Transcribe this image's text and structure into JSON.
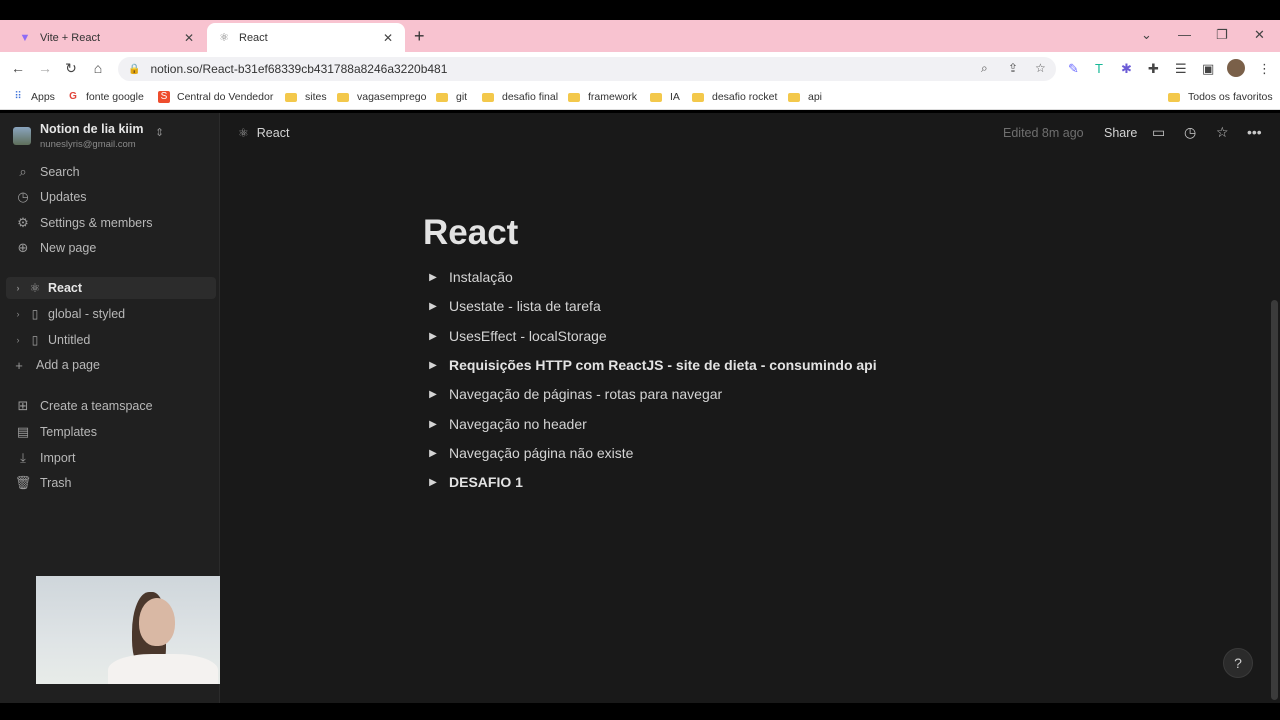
{
  "browser": {
    "tabs": [
      {
        "title": "Vite + React",
        "favicon": "vite-logo-icon",
        "active": false
      },
      {
        "title": "React",
        "favicon": "atom-icon",
        "active": true
      }
    ],
    "url": "notion.so/React-b31ef68339cb431788a8246a3220b481",
    "bookmarks": [
      {
        "label": "Apps",
        "icon": "apps-grid-icon"
      },
      {
        "label": "fonte google",
        "icon": "google-icon"
      },
      {
        "label": "Central do Vendedor",
        "icon": "shop-icon"
      },
      {
        "label": "sites",
        "icon": "folder-icon"
      },
      {
        "label": "vagasemprego",
        "icon": "folder-icon"
      },
      {
        "label": "git",
        "icon": "folder-icon"
      },
      {
        "label": "desafio final",
        "icon": "folder-icon"
      },
      {
        "label": "framework",
        "icon": "folder-icon"
      },
      {
        "label": "IA",
        "icon": "folder-icon"
      },
      {
        "label": "desafio rocket",
        "icon": "folder-icon"
      },
      {
        "label": "api",
        "icon": "folder-icon"
      }
    ],
    "all_bookmarks": "Todos os favoritos"
  },
  "sidebar": {
    "workspace_name": "Notion de lia kiim",
    "workspace_email": "nuneslyris@gmail.com",
    "actions": [
      {
        "label": "Search",
        "icon": "search-icon"
      },
      {
        "label": "Updates",
        "icon": "clock-icon"
      },
      {
        "label": "Settings & members",
        "icon": "gear-icon"
      },
      {
        "label": "New page",
        "icon": "plus-circle-icon"
      }
    ],
    "pages": [
      {
        "label": "React",
        "icon": "atom-icon",
        "selected": true
      },
      {
        "label": "global - styled",
        "icon": "page-icon",
        "selected": false
      },
      {
        "label": "Untitled",
        "icon": "page-icon",
        "selected": false
      }
    ],
    "add_page": "Add a page",
    "footer": [
      {
        "label": "Create a teamspace",
        "icon": "teamspace-icon"
      },
      {
        "label": "Templates",
        "icon": "templates-icon"
      },
      {
        "label": "Import",
        "icon": "download-icon"
      },
      {
        "label": "Trash",
        "icon": "trash-icon"
      }
    ]
  },
  "topbar": {
    "breadcrumb": "React",
    "edited": "Edited 8m ago",
    "share": "Share"
  },
  "page": {
    "title": "React",
    "toggles": [
      {
        "text": "Instalação",
        "bold": false
      },
      {
        "text": "Usestate - lista de tarefa",
        "bold": false
      },
      {
        "text": "UsesEffect - localStorage",
        "bold": false
      },
      {
        "text": "Requisições HTTP com ReactJS - site de dieta - consumindo api",
        "bold": true
      },
      {
        "text": "Navegação de páginas - rotas para navegar",
        "bold": false
      },
      {
        "text": "Navegação no header",
        "bold": false
      },
      {
        "text": "Navegação página não existe",
        "bold": false
      },
      {
        "text": "DESAFIO 1",
        "bold": true
      }
    ],
    "help": "?"
  }
}
